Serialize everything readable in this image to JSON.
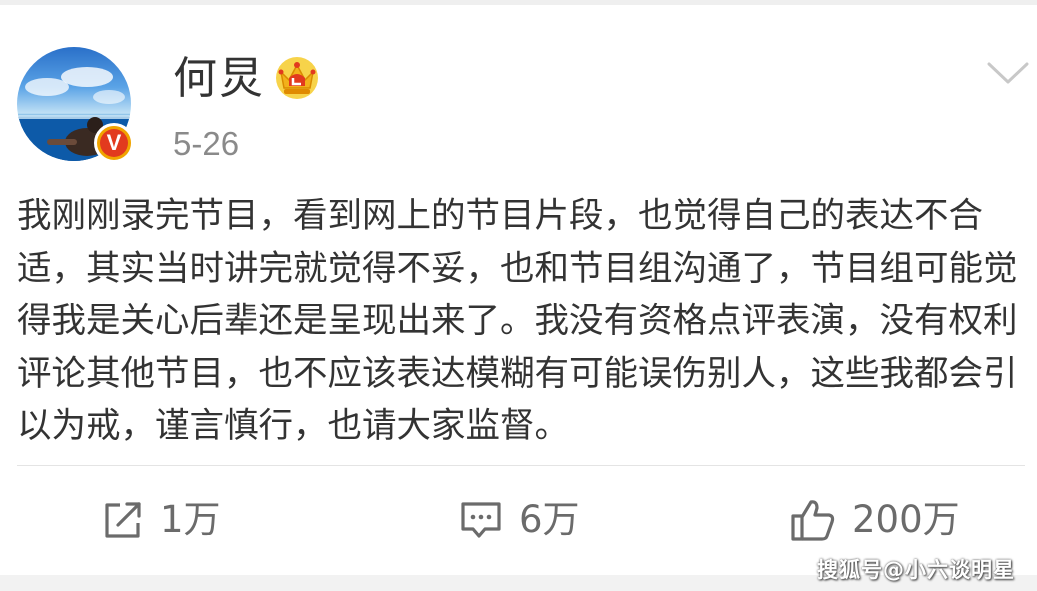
{
  "post": {
    "author": "何炅",
    "date": "5-26",
    "verified_badge": "V",
    "text": "我刚刚录完节目，看到网上的节目片段，也觉得自己的表达不合适，其实当时讲完就觉得不妥，也和节目组沟通了，节目组可能觉得我是关心后辈还是呈现出来了。我没有资格点评表演，没有权利评论其他节目，也不应该表达模糊有可能误伤别人，这些我都会引以为戒，谨言慎行，也请大家监督。"
  },
  "actions": {
    "repost_count": "1万",
    "comment_count": "6万",
    "like_count": "200万"
  },
  "icons": {
    "crown": "vip-crown-icon",
    "menu": "chevron-down-icon",
    "repost": "share-icon",
    "comment": "comment-icon",
    "like": "thumbs-up-icon"
  },
  "watermark": "搜狐号@小六谈明星",
  "colors": {
    "text": "#333333",
    "muted": "#8a8a8a",
    "badge_red": "#e23a1e",
    "badge_gold": "#f0a400"
  }
}
